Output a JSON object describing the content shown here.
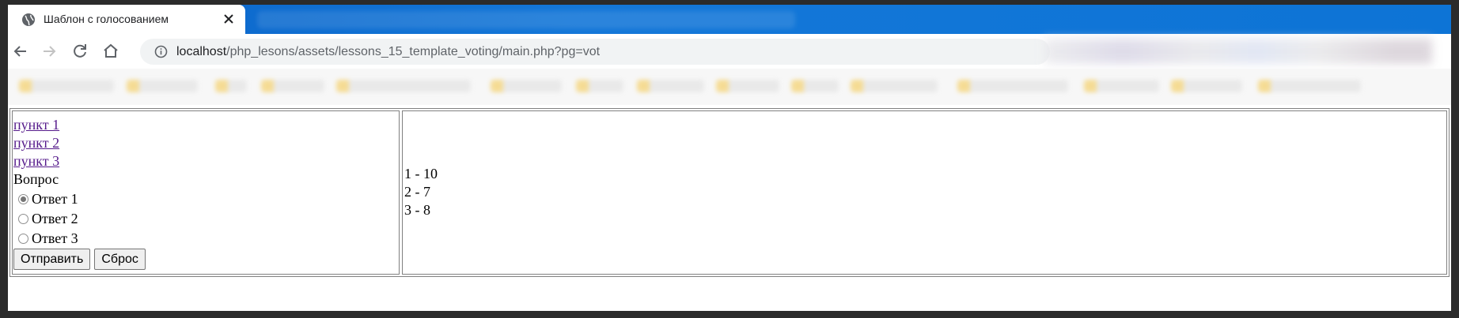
{
  "browser": {
    "tab_title": "Шаблон с голосованием",
    "url_host": "localhost",
    "url_path": "/php_lesons/assets/lessons_15_template_voting/main.php?pg=vot"
  },
  "page": {
    "menu": [
      "пункт 1",
      "пункт 2",
      "пункт 3"
    ],
    "question": "Вопрос",
    "answers": [
      {
        "label": "Ответ 1",
        "checked": true
      },
      {
        "label": "Ответ 2",
        "checked": false
      },
      {
        "label": "Ответ 3",
        "checked": false
      }
    ],
    "submit_label": "Отправить",
    "reset_label": "Сброс",
    "results": [
      "1 - 10",
      "2 - 7",
      "3 - 8"
    ]
  },
  "colors": {
    "tabstrip": "#0a63c8",
    "visited_link": "#551a8b"
  }
}
